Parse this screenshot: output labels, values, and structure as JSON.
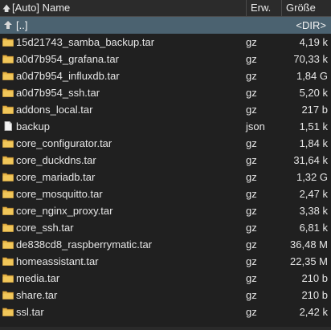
{
  "header": {
    "sort_icon": "up-arrow-icon",
    "name_label": "[Auto] Name",
    "ext_label": "Erw.",
    "size_label": "Größe"
  },
  "parent_row": {
    "icon": "parent-dir-arrow-icon",
    "name": "[..]",
    "size": "<DIR>"
  },
  "rows": [
    {
      "name": "15d21743_samba_backup.tar",
      "ext": "gz",
      "size": "4,19 k",
      "icon": "archive-folder-icon"
    },
    {
      "name": "a0d7b954_grafana.tar",
      "ext": "gz",
      "size": "70,33 k",
      "icon": "archive-folder-icon"
    },
    {
      "name": "a0d7b954_influxdb.tar",
      "ext": "gz",
      "size": "1,84 G",
      "icon": "archive-folder-icon"
    },
    {
      "name": "a0d7b954_ssh.tar",
      "ext": "gz",
      "size": "5,20 k",
      "icon": "archive-folder-icon"
    },
    {
      "name": "addons_local.tar",
      "ext": "gz",
      "size": "217 b",
      "icon": "archive-folder-icon"
    },
    {
      "name": "backup",
      "ext": "json",
      "size": "1,51 k",
      "icon": "file-icon"
    },
    {
      "name": "core_configurator.tar",
      "ext": "gz",
      "size": "1,84 k",
      "icon": "archive-folder-icon"
    },
    {
      "name": "core_duckdns.tar",
      "ext": "gz",
      "size": "31,64 k",
      "icon": "archive-folder-icon"
    },
    {
      "name": "core_mariadb.tar",
      "ext": "gz",
      "size": "1,32 G",
      "icon": "archive-folder-icon"
    },
    {
      "name": "core_mosquitto.tar",
      "ext": "gz",
      "size": "2,47 k",
      "icon": "archive-folder-icon"
    },
    {
      "name": "core_nginx_proxy.tar",
      "ext": "gz",
      "size": "3,38 k",
      "icon": "archive-folder-icon"
    },
    {
      "name": "core_ssh.tar",
      "ext": "gz",
      "size": "6,81 k",
      "icon": "archive-folder-icon"
    },
    {
      "name": "de838cd8_raspberrymatic.tar",
      "ext": "gz",
      "size": "36,48 M",
      "icon": "archive-folder-icon"
    },
    {
      "name": "homeassistant.tar",
      "ext": "gz",
      "size": "22,35 M",
      "icon": "archive-folder-icon"
    },
    {
      "name": "media.tar",
      "ext": "gz",
      "size": "210 b",
      "icon": "archive-folder-icon"
    },
    {
      "name": "share.tar",
      "ext": "gz",
      "size": "210 b",
      "icon": "archive-folder-icon"
    },
    {
      "name": "ssl.tar",
      "ext": "gz",
      "size": "2,42 k",
      "icon": "archive-folder-icon"
    }
  ],
  "colors": {
    "background": "#202020",
    "selected_row": "#4b6270",
    "folder_yellow": "#e8b74a",
    "text": "#e6e6e6"
  }
}
